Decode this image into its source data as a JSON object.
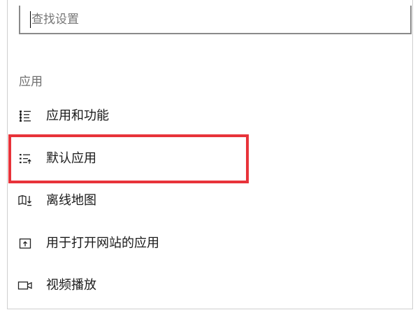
{
  "search": {
    "placeholder": "查找设置"
  },
  "section": {
    "title": "应用"
  },
  "nav_items": [
    {
      "label": "应用和功能",
      "icon": "apps-features-icon"
    },
    {
      "label": "默认应用",
      "icon": "default-apps-icon"
    },
    {
      "label": "离线地图",
      "icon": "offline-maps-icon"
    },
    {
      "label": "用于打开网站的应用",
      "icon": "apps-for-websites-icon"
    },
    {
      "label": "视频播放",
      "icon": "video-playback-icon"
    }
  ],
  "highlight": {
    "color": "#e8333a",
    "target": "默认应用"
  }
}
